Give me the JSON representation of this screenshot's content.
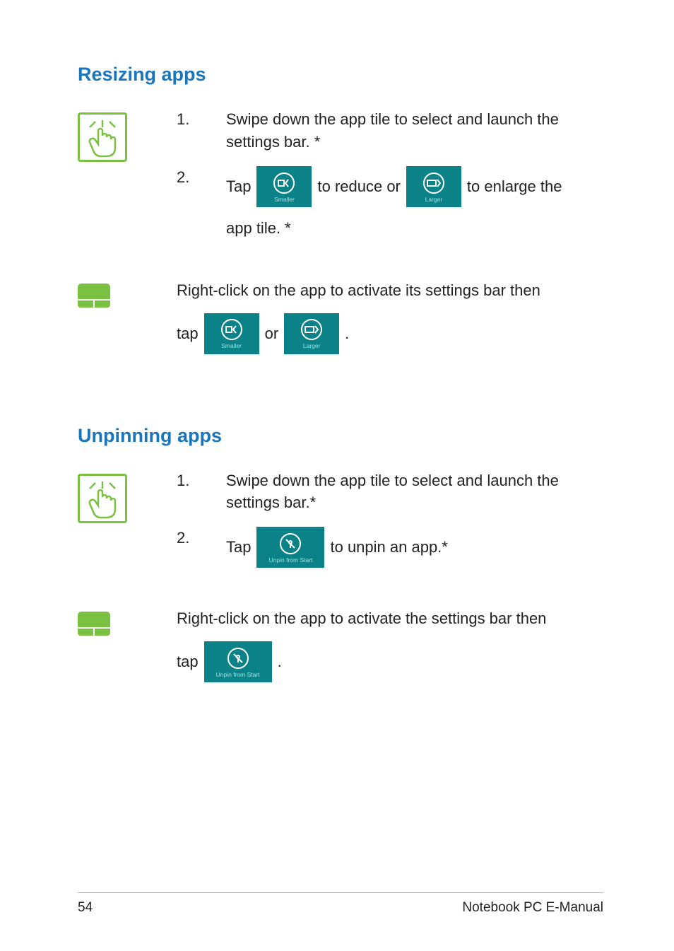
{
  "sections": {
    "resizing": {
      "heading": "Resizing apps",
      "touch_step1": "Swipe down the app tile to select and launch the settings bar. *",
      "touch_step2_a": "Tap",
      "touch_step2_b": "to reduce or",
      "touch_step2_c": "to enlarge the",
      "touch_step2_d": "app tile. *",
      "touchpad_line1": "Right-click on the app to activate its settings bar then",
      "touchpad_line2_a": "tap",
      "touchpad_line2_b": "or",
      "touchpad_line2_c": "."
    },
    "unpinning": {
      "heading": "Unpinning apps",
      "touch_step1": "Swipe down the app tile to select and launch the settings bar.*",
      "touch_step2_a": "Tap",
      "touch_step2_b": "to unpin an app.*",
      "touchpad_line1": "Right-click on the app to activate the settings bar then",
      "touchpad_line2_a": "tap",
      "touchpad_line2_b": "."
    }
  },
  "tiles": {
    "smaller": "Smaller",
    "larger": "Larger",
    "unpin": "Unpin from Start"
  },
  "nums": {
    "one": "1.",
    "two": "2."
  },
  "footer": {
    "page": "54",
    "title": "Notebook PC E-Manual"
  }
}
